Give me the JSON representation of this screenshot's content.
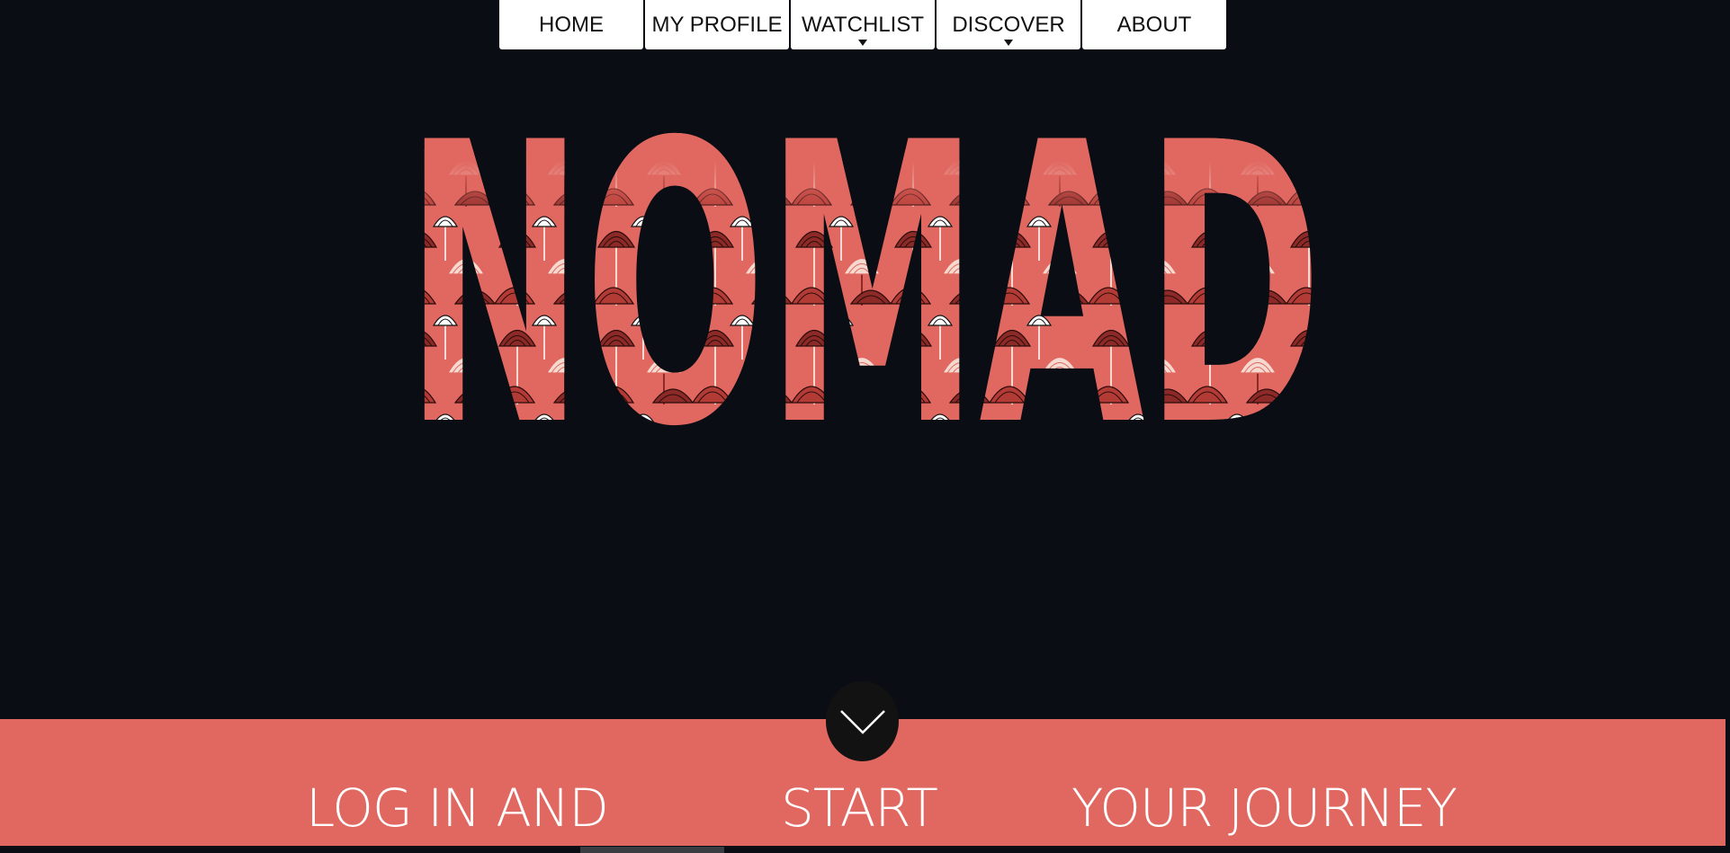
{
  "nav": {
    "items": [
      {
        "label": "HOME",
        "dropdown": false
      },
      {
        "label": "MY PROFILE",
        "dropdown": false
      },
      {
        "label": "WATCHLIST",
        "dropdown": true
      },
      {
        "label": "DISCOVER",
        "dropdown": true
      },
      {
        "label": "ABOUT",
        "dropdown": false
      }
    ]
  },
  "hero": {
    "logo_text": "NOMAD"
  },
  "scroll_button": {
    "icon": "chevron-down-icon"
  },
  "band": {
    "text_1": "LOG IN AND",
    "text_2": "START",
    "text_3": "YOUR JOURNEY"
  },
  "colors": {
    "background": "#0a0d13",
    "accent": "#e06861",
    "flower_dark": "#8c2a27",
    "flower_light": "#f6d9cf"
  }
}
